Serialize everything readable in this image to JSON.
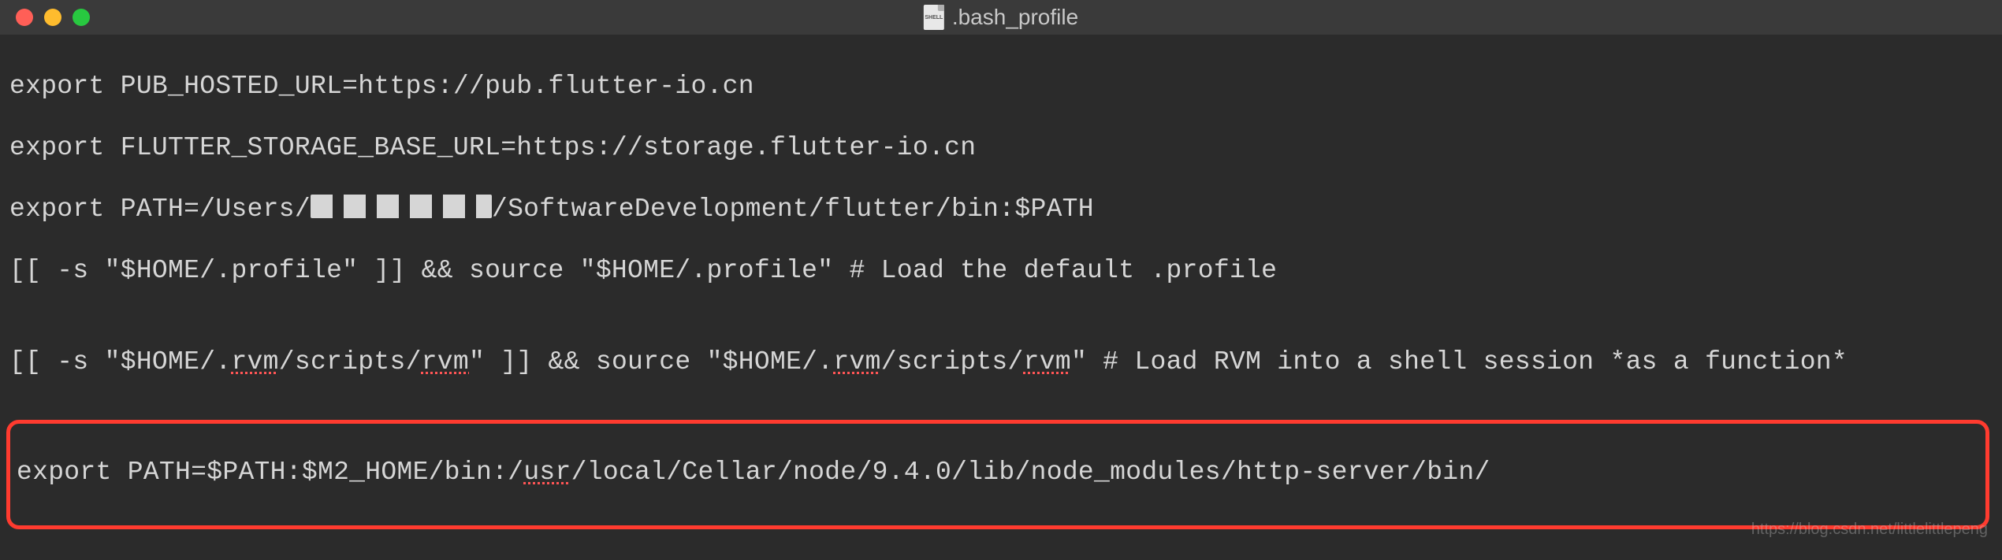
{
  "title": ".bash_profile",
  "file_icon_label": "SHELL",
  "lines": {
    "l1_a": "export PUB_HOSTED_URL=https://pub.flutter-io.cn",
    "l2_a": "export FLUTTER_STORAGE_BASE_URL=https://storage.flutter-io.cn",
    "l3_a": "export PATH=/Users/",
    "l3_b": "/SoftwareDevelopment/flutter/bin:$PATH",
    "l4_a": "[[ -s \"$HOME/.profile\" ]] && source \"$HOME/.profile\" # Load the default .profile",
    "l5_a": "",
    "l6_a": "[[ -s \"$HOME/.",
    "l6_rvm1": "rvm",
    "l6_b": "/scripts/",
    "l6_rvm2": "rvm",
    "l6_c": "\" ]] && source \"$HOME/.",
    "l6_rvm3": "rvm",
    "l6_d": "/scripts/",
    "l6_rvm4": "rvm",
    "l6_e": "\" # Load RVM into a shell session *as a function*",
    "hl_a": "export PATH=$PATH:$M2_HOME/bin:/",
    "hl_usr": "usr",
    "hl_b": "/local/Cellar/node/9.4.0/lib/node_modules/http-server/bin/"
  },
  "watermark": "https://blog.csdn.net/littlelittlepeng"
}
